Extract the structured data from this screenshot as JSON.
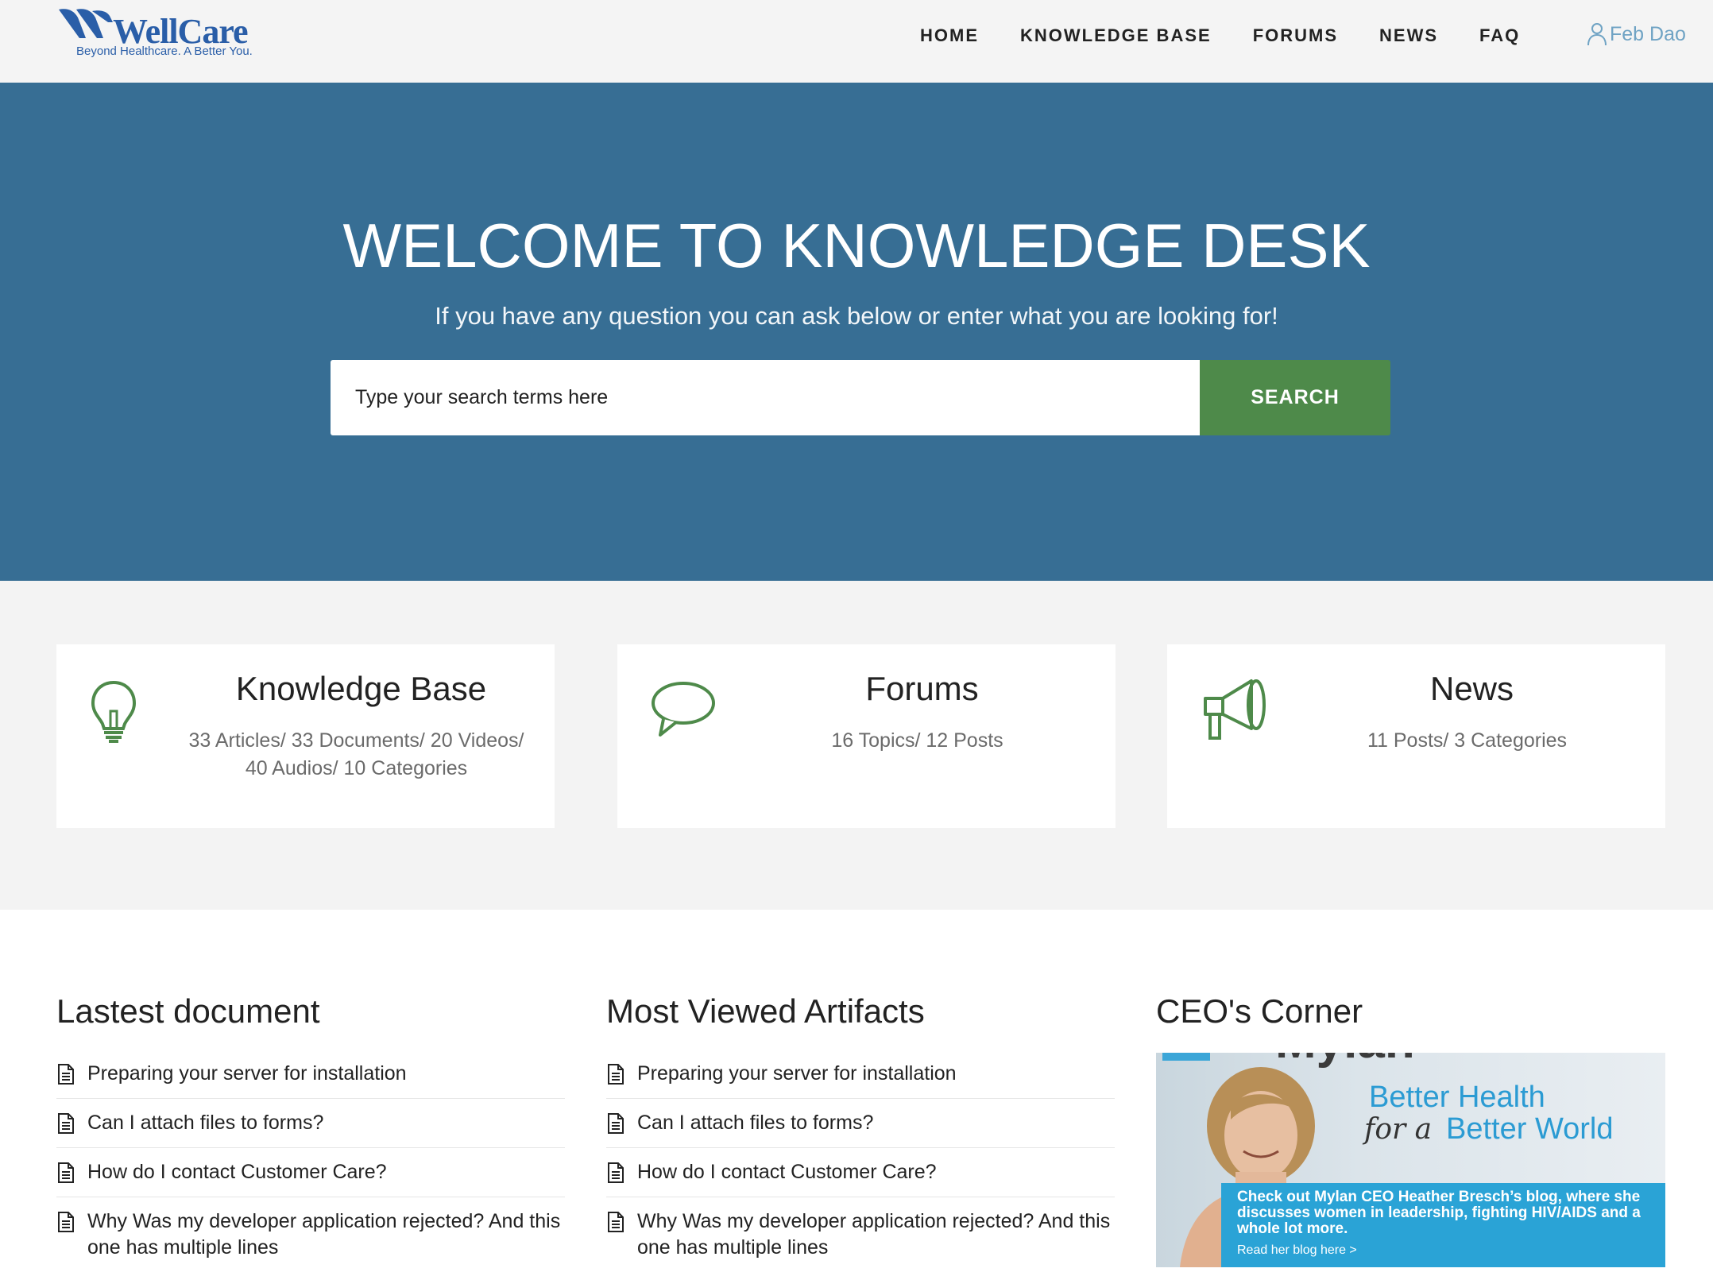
{
  "brand": {
    "name": "WellCare",
    "tagline": "Beyond Healthcare. A Better You.",
    "accent": "#2a5ea8"
  },
  "nav": {
    "items": [
      "HOME",
      "KNOWLEDGE BASE",
      "FORUMS",
      "NEWS",
      "FAQ"
    ],
    "user_name": "Feb Dao",
    "user_icon": "user-icon"
  },
  "hero": {
    "title": "WELCOME TO KNOWLEDGE DESK",
    "subtitle": "If you have any question you can ask below or enter what you are looking for!",
    "search_placeholder": "Type your search terms here",
    "search_button": "SEARCH",
    "background": "#376e94",
    "button_color": "#4e8a4a"
  },
  "cards": [
    {
      "title": "Knowledge Base",
      "desc": "33 Articles/ 33 Documents/ 20 Videos/ 40 Audios/ 10 Categories",
      "icon": "lightbulb-icon"
    },
    {
      "title": "Forums",
      "desc": "16 Topics/ 12 Posts",
      "icon": "speech-bubble-icon"
    },
    {
      "title": "News",
      "desc": "11 Posts/ 3 Categories",
      "icon": "megaphone-icon"
    }
  ],
  "latest": {
    "heading": "Lastest document",
    "items": [
      "Preparing your server for installation",
      "Can I attach files to forms?",
      "How do I contact Customer Care?",
      "Why Was my developer application rejected? And this one has multiple lines"
    ]
  },
  "most_viewed": {
    "heading": "Most Viewed Artifacts",
    "items": [
      "Preparing your server for installation",
      "Can I attach files to forms?",
      "How do I contact Customer Care?",
      "Why Was my developer application rejected? And this one has multiple lines"
    ]
  },
  "ceo": {
    "heading": "CEO's Corner",
    "banner_brand": "Mylan",
    "headline_1": "Better Health",
    "headline_for": "for a",
    "headline_2": "Better World",
    "blurb": "Check out Mylan CEO Heather Bresch’s blog, where she discusses women in leadership, fighting HIV/AIDS and a whole lot more.",
    "link": "Read her blog here >"
  }
}
